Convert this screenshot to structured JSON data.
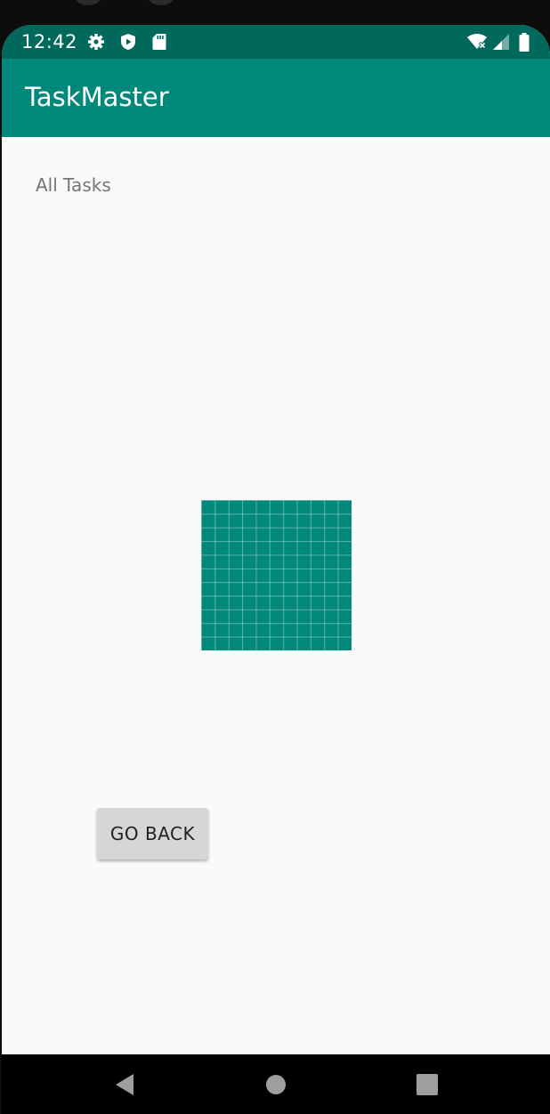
{
  "status_bar": {
    "time": "12:42",
    "icons_left": [
      "settings-icon",
      "shield-play-icon",
      "sd-card-icon"
    ],
    "icons_right": [
      "wifi-off-icon",
      "signal-icon",
      "battery-icon"
    ],
    "color": "#00695c"
  },
  "app_bar": {
    "title": "TaskMaster",
    "color": "#00897b"
  },
  "main": {
    "section_label": "All Tasks",
    "image_placeholder": "grid-image-placeholder",
    "go_back_label": "GO BACK"
  },
  "nav_bar": {
    "buttons": [
      "back-icon",
      "home-icon",
      "recents-icon"
    ]
  }
}
